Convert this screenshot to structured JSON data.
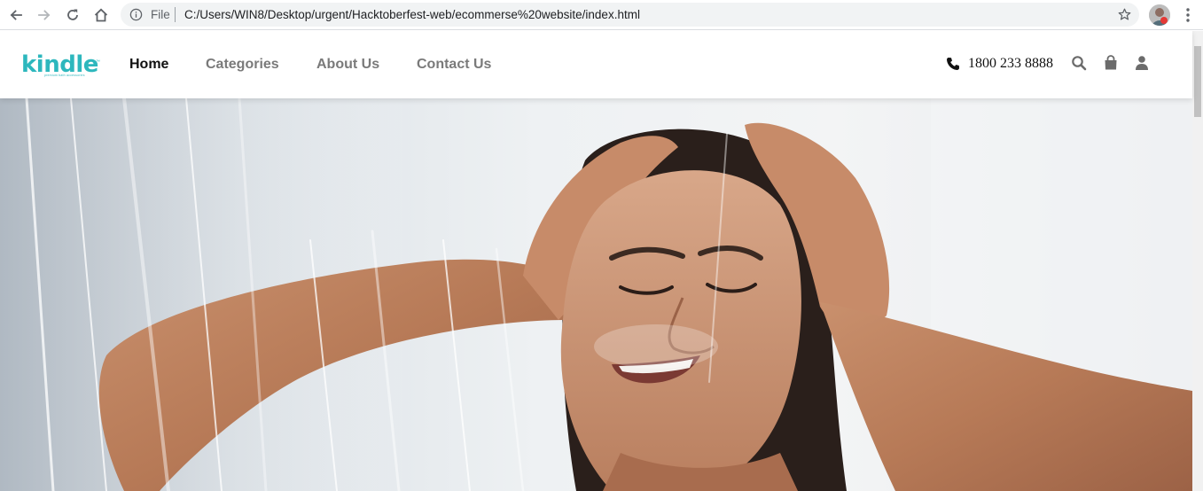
{
  "browser": {
    "scheme_label": "File",
    "url": "C:/Users/WIN8/Desktop/urgent/Hacktoberfest-web/ecommerse%20website/index.html",
    "icons": {
      "back": "arrow-left-icon",
      "forward": "arrow-right-icon",
      "reload": "reload-icon",
      "home": "home-icon",
      "info": "info-icon",
      "bookmark": "star-icon",
      "menu": "kebab-menu-icon"
    }
  },
  "site": {
    "brand": {
      "name": "kindle",
      "tagline": "premium bath accessories",
      "trademark": "™",
      "color": "#2db7bd"
    },
    "nav": [
      {
        "label": "Home",
        "active": true
      },
      {
        "label": "Categories",
        "active": false
      },
      {
        "label": "About Us",
        "active": false
      },
      {
        "label": "Contact Us",
        "active": false
      }
    ],
    "contact": {
      "phone": "1800 233 8888"
    },
    "header_icons": [
      "search-icon",
      "shopping-bag-icon",
      "user-icon"
    ]
  },
  "hero": {
    "image": "woman-in-shower"
  }
}
